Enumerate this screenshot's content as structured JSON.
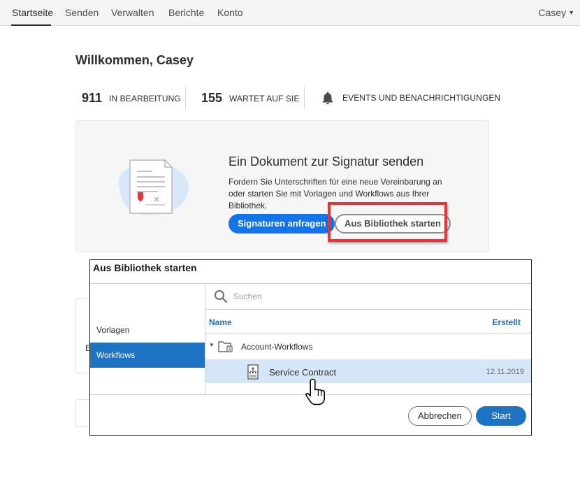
{
  "nav": {
    "items": [
      {
        "label": "Startseite",
        "active": true
      },
      {
        "label": "Senden",
        "active": false
      },
      {
        "label": "Verwalten",
        "active": false
      },
      {
        "label": "Berichte",
        "active": false
      },
      {
        "label": "Konto",
        "active": false
      }
    ],
    "user": "Casey"
  },
  "welcome": "Willkommen, Casey",
  "stats": {
    "in_progress": {
      "count": "911",
      "label": "IN BEARBEITUNG"
    },
    "waiting": {
      "count": "155",
      "label": "WARTET AUF SIE"
    },
    "events": {
      "label": "EVENTS UND BENACHRICHTIGUNGEN"
    }
  },
  "send_card": {
    "title": "Ein Dokument zur Signatur senden",
    "description": "Fordern Sie Unterschriften für eine neue Vereinbarung an oder starten Sie mit Vorlagen und Workflows aus Ihrer Bibliothek.",
    "primary_button": "Signaturen anfragen",
    "secondary_button": "Aus Bibliothek starten"
  },
  "background_card": {
    "partial_letter": "E"
  },
  "dialog": {
    "title": "Aus Bibliothek starten",
    "left_items": [
      {
        "label": "Vorlagen",
        "selected": false
      },
      {
        "label": "Workflows",
        "selected": true
      }
    ],
    "search": {
      "placeholder": "Suchen"
    },
    "columns": {
      "name": "Name",
      "created": "Erstellt"
    },
    "folder": {
      "label": "Account-Workflows"
    },
    "items": [
      {
        "label": "Service Contract",
        "date": "12.11.2019",
        "selected": true
      }
    ],
    "cancel_button": "Abbrechen",
    "start_button": "Start"
  },
  "colors": {
    "primary_blue": "#1473e6",
    "selection_blue": "#1f73c5",
    "row_highlight": "#d5e6f8",
    "annotation_red": "#e8333a"
  }
}
